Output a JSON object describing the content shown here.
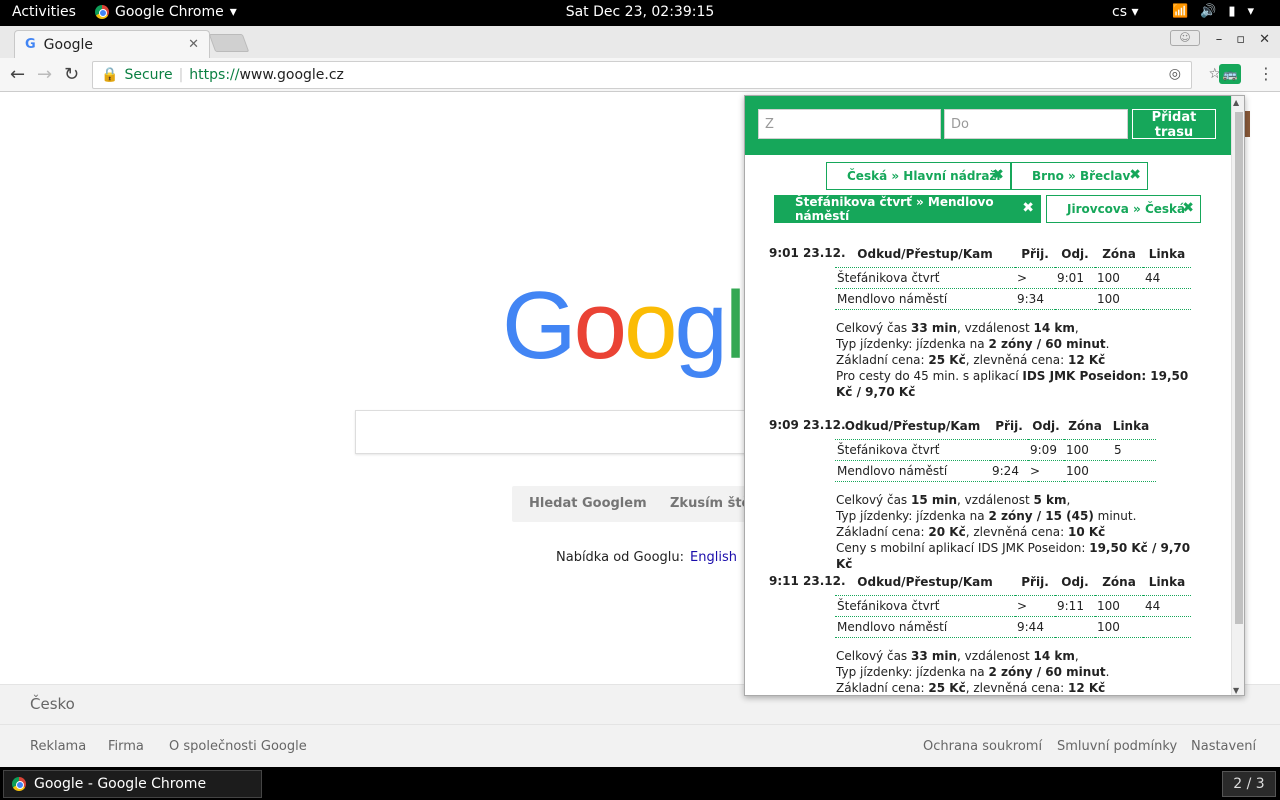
{
  "system": {
    "activities": "Activities",
    "app_name": "Google Chrome",
    "clock": "Sat Dec 23, 02:39:15",
    "lang": "cs"
  },
  "browser": {
    "tab_title": "Google",
    "url_secure": "Secure",
    "url_scheme": "https://",
    "url_host": "www.google.cz"
  },
  "google": {
    "logo": "Google",
    "btn_search": "Hledat Googlem",
    "btn_lucky": "Zkusím štěstí",
    "offered": "Nabídka od Googlu:",
    "offered_lang": "English",
    "country": "Česko",
    "footer_left": [
      "Reklama",
      "Firma",
      "O společnosti Google"
    ],
    "footer_right": [
      "Ochrana soukromí",
      "Smluvní podmínky",
      "Nastavení"
    ]
  },
  "taskbar": {
    "window": "Google - Google Chrome",
    "workspace": "2 / 3"
  },
  "popup": {
    "from_placeholder": "Z",
    "to_placeholder": "Do",
    "add_label": "Přidat trasu",
    "routes": [
      {
        "label": "Česká » Hlavní nádraží",
        "active": false
      },
      {
        "label": "Brno » Břeclav",
        "active": false
      },
      {
        "label": "Štefánikova čtvrť » Mendlovo náměstí",
        "active": true
      },
      {
        "label": "Jirovcova » Česká",
        "active": false
      }
    ],
    "headers": [
      "Odkud/Přestup/Kam",
      "Přij.",
      "Odj.",
      "Zóna",
      "Linka"
    ],
    "connections": [
      {
        "time": "9:01",
        "date": "23.12.",
        "rows": [
          [
            "Štefánikova čtvrť",
            ">",
            "9:01",
            "100",
            "44"
          ],
          [
            "Mendlovo náměstí",
            "9:34",
            "",
            "100",
            ""
          ]
        ],
        "info": [
          [
            "Celkový čas ",
            "33 min",
            ", vzdálenost ",
            "14 km",
            ","
          ],
          [
            "Typ jízdenky: jízdenka na ",
            "2 zóny / 60 minut",
            "."
          ],
          [
            "Základní cena: ",
            "25 Kč",
            ", zlevněná cena: ",
            "12 Kč"
          ],
          [
            "Pro cesty do 45 min. s aplikací ",
            "IDS JMK Poseidon: 19,50 Kč / 9,70 Kč"
          ]
        ]
      },
      {
        "time": "9:09",
        "date": "23.12.",
        "rows": [
          [
            "Štefánikova čtvrť",
            "",
            "9:09",
            "100",
            "5"
          ],
          [
            "Mendlovo náměstí",
            "9:24",
            ">",
            "100",
            ""
          ]
        ],
        "info": [
          [
            "Celkový čas ",
            "15 min",
            ", vzdálenost ",
            "5 km",
            ","
          ],
          [
            "Typ jízdenky: jízdenka na ",
            "2 zóny / 15 (45)",
            " minut."
          ],
          [
            "Základní cena: ",
            "20 Kč",
            ", zlevněná cena: ",
            "10 Kč"
          ],
          [
            "Ceny s mobilní aplikací IDS JMK Poseidon: ",
            "19,50 Kč / 9,70 Kč"
          ]
        ]
      },
      {
        "time": "9:11",
        "date": "23.12.",
        "rows": [
          [
            "Štefánikova čtvrť",
            ">",
            "9:11",
            "100",
            "44"
          ],
          [
            "Mendlovo náměstí",
            "9:44",
            "",
            "100",
            ""
          ]
        ],
        "info": [
          [
            "Celkový čas ",
            "33 min",
            ", vzdálenost ",
            "14 km",
            ","
          ],
          [
            "Typ jízdenky: jízdenka na ",
            "2 zóny / 60 minut",
            "."
          ],
          [
            "Základní cena: ",
            "25 Kč",
            ", zlevněná cena: ",
            "12 Kč"
          ]
        ]
      }
    ]
  }
}
